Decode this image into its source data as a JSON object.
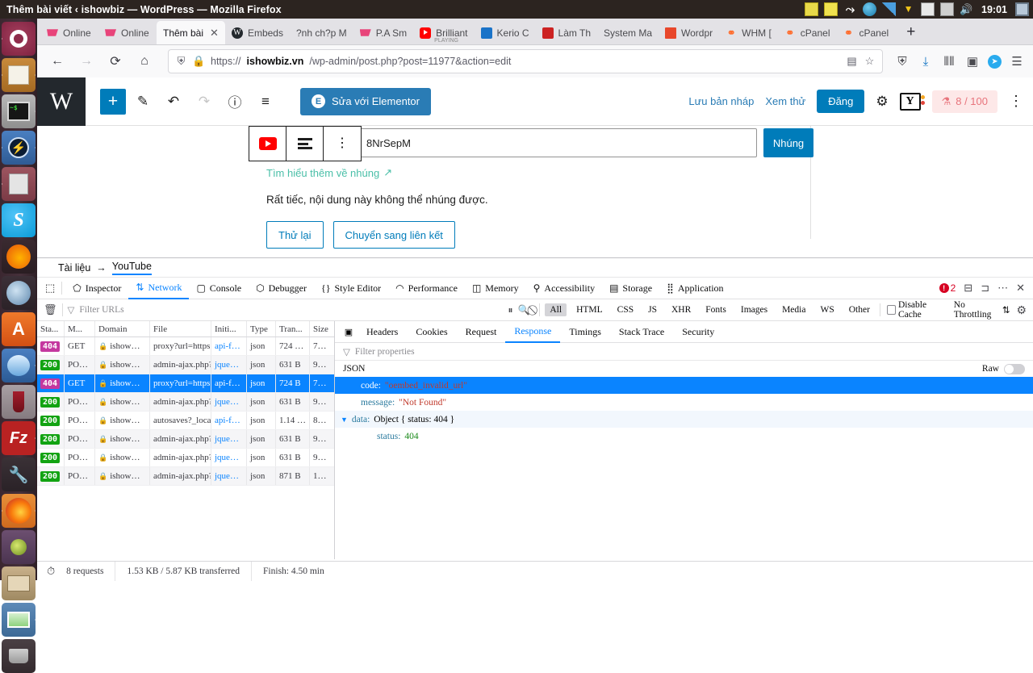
{
  "os": {
    "window_title": "Thêm bài viết ‹ ishowbiz — WordPress — Mozilla Firefox",
    "clock": "19:01",
    "tray_icons": [
      "notepad-icon",
      "z-icon",
      "weather-icon",
      "signal-icon",
      "vlc-icon",
      "mail-icon",
      "printer-icon",
      "volume-icon",
      "display-icon"
    ]
  },
  "dock": {
    "items": [
      {
        "name": "ubuntu-dash",
        "label": "Dash"
      },
      {
        "name": "notes-app",
        "label": "Notes"
      },
      {
        "name": "terminal",
        "label": "Terminal"
      },
      {
        "name": "blue-app",
        "label": "Zalo"
      },
      {
        "name": "printer-app",
        "label": "Printer"
      },
      {
        "name": "skype",
        "label": "Skype"
      },
      {
        "name": "firefox-dev",
        "label": "Firefox Developer"
      },
      {
        "name": "chromium",
        "label": "Chromium"
      },
      {
        "name": "acrobat",
        "label": "Acrobat"
      },
      {
        "name": "thunderbird",
        "label": "Thunderbird"
      },
      {
        "name": "wine",
        "label": "Wine"
      },
      {
        "name": "filezilla",
        "label": "FileZilla"
      },
      {
        "name": "tools",
        "label": "System Tools"
      },
      {
        "name": "firefox",
        "label": "Firefox"
      },
      {
        "name": "gimp",
        "label": "GIMP"
      },
      {
        "name": "files",
        "label": "Files"
      },
      {
        "name": "image-viewer",
        "label": "Image Viewer"
      },
      {
        "name": "trash",
        "label": "Trash"
      }
    ]
  },
  "browser": {
    "tabs": [
      {
        "label": "Online",
        "favicon": "cart-icon",
        "active": false,
        "sub": ""
      },
      {
        "label": "Online",
        "favicon": "cart-icon",
        "active": false,
        "sub": ""
      },
      {
        "label": "Thêm bài",
        "favicon": "none",
        "active": true,
        "sub": ""
      },
      {
        "label": "Embeds",
        "favicon": "wordpress-icon",
        "active": false,
        "sub": ""
      },
      {
        "label": "?nh ch?p M",
        "favicon": "none",
        "active": false,
        "sub": ""
      },
      {
        "label": "P.A Sm",
        "favicon": "cart-icon",
        "active": false,
        "sub": ""
      },
      {
        "label": "Brilliant",
        "favicon": "youtube-icon",
        "active": false,
        "sub": "PLAYING"
      },
      {
        "label": "Kerio C",
        "favicon": "kerio-icon",
        "active": false,
        "sub": ""
      },
      {
        "label": "Làm Th",
        "favicon": "lamtho-icon",
        "active": false,
        "sub": ""
      },
      {
        "label": "System Ma",
        "favicon": "none",
        "active": false,
        "sub": ""
      },
      {
        "label": "Wordpr",
        "favicon": "gift-icon",
        "active": false,
        "sub": ""
      },
      {
        "label": "WHM [",
        "favicon": "cpanel-icon",
        "active": false,
        "sub": ""
      },
      {
        "label": "cPanel",
        "favicon": "cpanel-icon",
        "active": false,
        "sub": ""
      },
      {
        "label": "cPanel",
        "favicon": "cpanel-icon",
        "active": false,
        "sub": ""
      }
    ],
    "new_tab_label": "+",
    "nav": {
      "back": "←",
      "forward": "→",
      "reload": "⟳",
      "home": "⌂",
      "url_scheme": "https://",
      "url_host": "ishowbiz.vn",
      "url_path": "/wp-admin/post.php?post=11977&action=edit",
      "reader_icon": "reader-view-icon",
      "bookmark_icon": "star-icon",
      "right_icons": [
        "shield-icon",
        "downloads-icon",
        "library-icon",
        "sidebar-icon",
        "telegram-icon",
        "menu-icon"
      ]
    }
  },
  "wpadmin": {
    "logo": "W",
    "toolbar": {
      "add_block": "+",
      "edit_icon": "pencil-icon",
      "undo_icon": "undo-icon",
      "redo_icon": "redo-icon",
      "info_icon": "info-icon",
      "list_view_icon": "list-view-icon",
      "elementor_label": "Sửa với Elementor",
      "elementor_badge": "E"
    },
    "right": {
      "save_draft": "Lưu bản nháp",
      "preview": "Xem thử",
      "publish": "Đăng",
      "settings_icon": "gear-icon",
      "yoast_icon": "yoast-icon",
      "seo_score": "8 / 100",
      "more_icon": "kebab-icon"
    }
  },
  "editor": {
    "block_toolbar": {
      "provider_icon": "youtube-icon",
      "align_icon": "align-icon",
      "more_icon": "kebab-icon"
    },
    "embed_url_value": "8NrSepM",
    "embed_button": "Nhúng",
    "help_link": "Tìm hiểu thêm về nhúng",
    "help_link_icon": "external-link-icon",
    "error_text": "Rất tiếc, nội dung này không thể nhúng được.",
    "actions": [
      "Thử lại",
      "Chuyển sang liên kết"
    ]
  },
  "devtools": {
    "breadcrumb": {
      "root": "Tài liệu",
      "arrow": "→",
      "current": "YouTube"
    },
    "picker_icon": "element-picker-icon",
    "tabs": [
      {
        "label": "Inspector",
        "icon": "inspector-icon",
        "active": false
      },
      {
        "label": "Network",
        "icon": "network-icon",
        "active": true
      },
      {
        "label": "Console",
        "icon": "console-icon",
        "active": false
      },
      {
        "label": "Debugger",
        "icon": "debugger-icon",
        "active": false
      },
      {
        "label": "Style Editor",
        "icon": "style-editor-icon",
        "active": false
      },
      {
        "label": "Performance",
        "icon": "performance-icon",
        "active": false
      },
      {
        "label": "Memory",
        "icon": "memory-icon",
        "active": false
      },
      {
        "label": "Accessibility",
        "icon": "accessibility-icon",
        "active": false
      },
      {
        "label": "Storage",
        "icon": "storage-icon",
        "active": false
      },
      {
        "label": "Application",
        "icon": "application-icon",
        "active": false
      }
    ],
    "error_count": "2",
    "right_icons": [
      "dock-bottom-icon",
      "dock-side-icon",
      "more-icon",
      "close-icon"
    ],
    "toolbar": {
      "clear_icon": "trash-icon",
      "filter_placeholder": "Filter URLs",
      "pause_icon": "pause-icon",
      "search_icon": "search-icon",
      "block_icon": "block-icon",
      "filters": [
        "All",
        "HTML",
        "CSS",
        "JS",
        "XHR",
        "Fonts",
        "Images",
        "Media",
        "WS",
        "Other"
      ],
      "active_filter": "All",
      "disable_cache": "Disable Cache",
      "throttling": "No Throttling",
      "settings_icon": "gear-icon"
    },
    "columns": [
      "Sta...",
      "M...",
      "Domain",
      "File",
      "Initi...",
      "Type",
      "Tran...",
      "Size"
    ],
    "requests": [
      {
        "status": "404",
        "status_type": "error",
        "method": "GET",
        "domain": "ishow…",
        "file": "proxy?url=https",
        "initiator": "api-f…",
        "type": "json",
        "transferred": "724 …",
        "size": "7…",
        "selected": false
      },
      {
        "status": "200",
        "status_type": "ok",
        "method": "PO…",
        "domain": "ishow…",
        "file": "admin-ajax.php?",
        "initiator": "jque…",
        "type": "json",
        "transferred": "631 B",
        "size": "9…",
        "selected": false
      },
      {
        "status": "404",
        "status_type": "error",
        "method": "GET",
        "domain": "ishow…",
        "file": "proxy?url=https",
        "initiator": "api-f…",
        "type": "json",
        "transferred": "724 B",
        "size": "7…",
        "selected": true
      },
      {
        "status": "200",
        "status_type": "ok",
        "method": "PO…",
        "domain": "ishow…",
        "file": "admin-ajax.php?",
        "initiator": "jque…",
        "type": "json",
        "transferred": "631 B",
        "size": "9…",
        "selected": false
      },
      {
        "status": "200",
        "status_type": "ok",
        "method": "PO…",
        "domain": "ishow…",
        "file": "autosaves?_local",
        "initiator": "api-f…",
        "type": "json",
        "transferred": "1.14 …",
        "size": "8…",
        "selected": false
      },
      {
        "status": "200",
        "status_type": "ok",
        "method": "PO…",
        "domain": "ishow…",
        "file": "admin-ajax.php?",
        "initiator": "jque…",
        "type": "json",
        "transferred": "631 B",
        "size": "9…",
        "selected": false
      },
      {
        "status": "200",
        "status_type": "ok",
        "method": "PO…",
        "domain": "ishow…",
        "file": "admin-ajax.php?",
        "initiator": "jque…",
        "type": "json",
        "transferred": "631 B",
        "size": "9…",
        "selected": false
      },
      {
        "status": "200",
        "status_type": "ok",
        "method": "PO…",
        "domain": "ishow…",
        "file": "admin-ajax.php?",
        "initiator": "jque…",
        "type": "json",
        "transferred": "871 B",
        "size": "1…",
        "selected": false
      }
    ],
    "detail": {
      "tabs": [
        {
          "label": "Headers",
          "active": false
        },
        {
          "label": "Cookies",
          "active": false
        },
        {
          "label": "Request",
          "active": false
        },
        {
          "label": "Response",
          "active": true
        },
        {
          "label": "Timings",
          "active": false
        },
        {
          "label": "Stack Trace",
          "active": false
        },
        {
          "label": "Security",
          "active": false
        }
      ],
      "filter_placeholder": "Filter properties",
      "json_label": "JSON",
      "raw_label": "Raw",
      "rows": [
        {
          "key": "code:",
          "value": "\"oembed_invalid_url\"",
          "value_type": "string",
          "indent": 1,
          "selected": true,
          "twisty": ""
        },
        {
          "key": "message:",
          "value": "\"Not Found\"",
          "value_type": "string",
          "indent": 1,
          "selected": false,
          "twisty": ""
        },
        {
          "key": "data:",
          "value": "Object { status: 404 }",
          "value_type": "object",
          "indent": 0,
          "selected": false,
          "twisty": "▼"
        },
        {
          "key": "status:",
          "value": "404",
          "value_type": "number",
          "indent": 2,
          "selected": false,
          "twisty": ""
        }
      ]
    },
    "status": {
      "clock_icon": "timer-icon",
      "requests": "8 requests",
      "transferred": "1.53 KB / 5.87 KB transferred",
      "finish": "Finish: 4.50 min"
    }
  },
  "colors": {
    "accent_blue": "#0a84ff",
    "wp_blue": "#007cba",
    "status_ok": "#12a312",
    "status_error": "#c4389f",
    "error_red": "#d70022",
    "link_teal": "#4abfa8"
  }
}
